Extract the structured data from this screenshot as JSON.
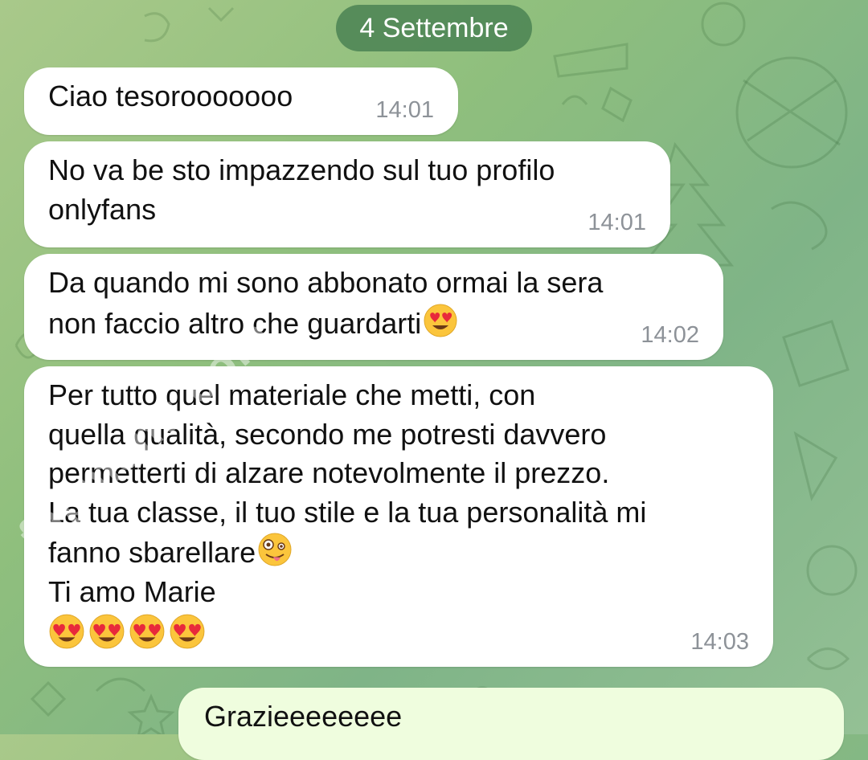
{
  "chat": {
    "date_separator": "4 Settembre",
    "messages": [
      {
        "text": "Ciao tesorooooooo",
        "time": "14:01",
        "direction": "in"
      },
      {
        "text": "No va be sto impazzendo sul tuo profilo\nonlyfans",
        "time": "14:01",
        "direction": "in"
      },
      {
        "text": "Da quando mi sono abbonato ormai la sera\nnon faccio altro che guardarti",
        "emoji": "heart-eyes-emoji",
        "time": "14:02",
        "direction": "in"
      },
      {
        "text": "Per tutto quel materiale che metti, con\nquella qualità, secondo me potresti davvero\npermetterti di alzare notevolmente il prezzo.\nLa tua classe, il tuo stile e la tua personalità mi\nfanno sbarellare",
        "text_after_emoji": "Ti amo Marie",
        "emoji": "zany-face-emoji",
        "emoji_row": [
          "heart-eyes-emoji",
          "heart-eyes-emoji",
          "heart-eyes-emoji",
          "heart-eyes-emoji"
        ],
        "time": "14:03",
        "direction": "in"
      },
      {
        "text": "Grazieeeeeeee",
        "direction": "out"
      }
    ]
  },
  "watermark": {
    "text": "fapmenu.com"
  },
  "colors": {
    "background": "#8fbf7d",
    "incoming_bubble": "#ffffff",
    "outgoing_bubble": "#effdde",
    "date_pill": "#488052",
    "timestamp": "#8d9298"
  }
}
